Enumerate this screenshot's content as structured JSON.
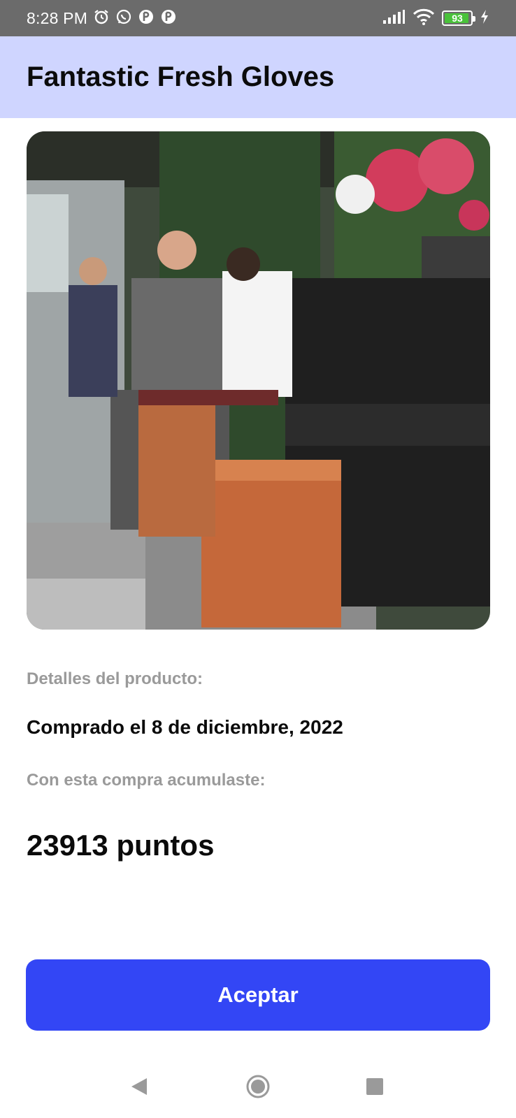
{
  "status_bar": {
    "time": "8:28 PM",
    "battery_level": "93",
    "icons_left": [
      "alarm-icon",
      "whatsapp-icon",
      "app-notification-icon",
      "app-notification-icon"
    ],
    "icons_right": [
      "signal-icon",
      "wifi-icon",
      "battery-icon",
      "charging-icon"
    ],
    "battery_color": "#49c23a"
  },
  "app_bar": {
    "title": "Fantastic Fresh Gloves",
    "background": "#cfd5ff"
  },
  "product": {
    "image_alt": "product-photo"
  },
  "details": {
    "label": "Detalles del producto:",
    "purchase_date": "Comprado el 8 de diciembre, 2022",
    "points_label": "Con esta compra acumulaste:",
    "points_value": "23913 puntos"
  },
  "actions": {
    "accept_label": "Aceptar",
    "accent_color": "#3346f5"
  },
  "nav_bar": {
    "icons": [
      "back-icon",
      "home-icon",
      "recents-icon"
    ]
  }
}
